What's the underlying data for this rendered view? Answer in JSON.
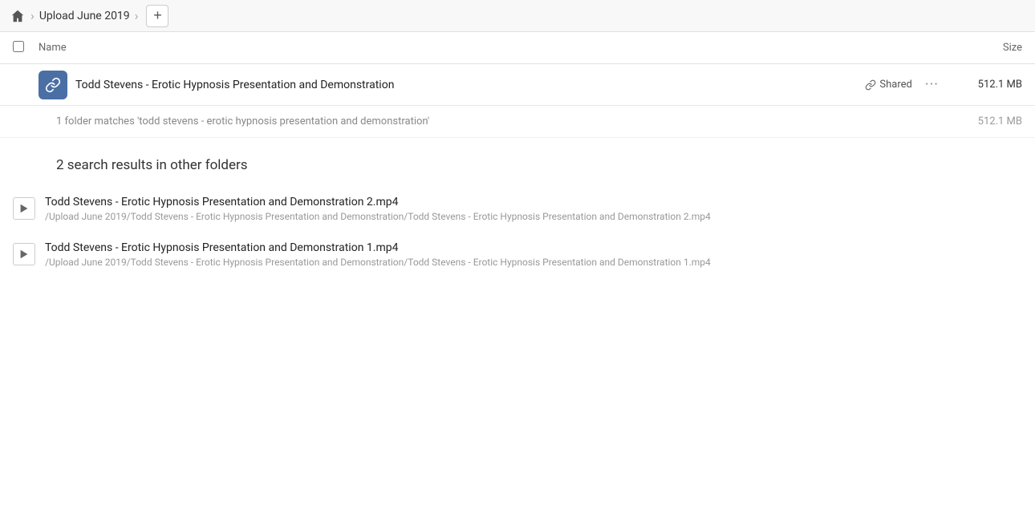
{
  "breadcrumb": {
    "home_label": "Home",
    "folder_label": "Upload June 2019",
    "add_button_label": "+"
  },
  "columns": {
    "name_label": "Name",
    "size_label": "Size"
  },
  "main_folder": {
    "name": "Todd Stevens - Erotic Hypnosis Presentation and Demonstration",
    "shared_label": "Shared",
    "size": "512.1 MB"
  },
  "summary": {
    "text": "1 folder matches 'todd stevens - erotic hypnosis presentation and demonstration'",
    "size": "512.1 MB"
  },
  "other_results": {
    "header": "2 search results in other folders",
    "items": [
      {
        "filename": "Todd Stevens - Erotic Hypnosis Presentation and Demonstration 2.mp4",
        "path": "/Upload June 2019/Todd Stevens - Erotic Hypnosis Presentation and Demonstration/Todd Stevens - Erotic Hypnosis Presentation and Demonstration 2.mp4"
      },
      {
        "filename": "Todd Stevens - Erotic Hypnosis Presentation and Demonstration 1.mp4",
        "path": "/Upload June 2019/Todd Stevens - Erotic Hypnosis Presentation and Demonstration/Todd Stevens - Erotic Hypnosis Presentation and Demonstration 1.mp4"
      }
    ]
  }
}
